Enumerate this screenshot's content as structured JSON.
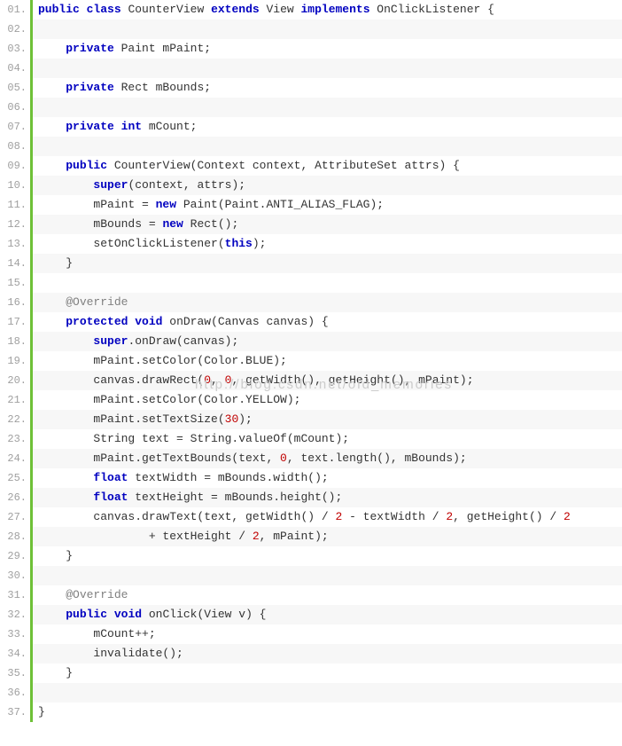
{
  "watermark": "http://blog.csdn.net/old_memories",
  "lines": [
    {
      "n": "01.",
      "tokens": [
        {
          "t": "txt",
          "v": ""
        },
        {
          "t": "kw",
          "v": "public"
        },
        {
          "t": "txt",
          "v": " "
        },
        {
          "t": "kw",
          "v": "class"
        },
        {
          "t": "txt",
          "v": " CounterView "
        },
        {
          "t": "kw",
          "v": "extends"
        },
        {
          "t": "txt",
          "v": " View "
        },
        {
          "t": "kw",
          "v": "implements"
        },
        {
          "t": "txt",
          "v": " OnClickListener {"
        }
      ]
    },
    {
      "n": "02.",
      "tokens": []
    },
    {
      "n": "03.",
      "tokens": [
        {
          "t": "txt",
          "v": "    "
        },
        {
          "t": "kw",
          "v": "private"
        },
        {
          "t": "txt",
          "v": " Paint mPaint;"
        }
      ]
    },
    {
      "n": "04.",
      "tokens": []
    },
    {
      "n": "05.",
      "tokens": [
        {
          "t": "txt",
          "v": "    "
        },
        {
          "t": "kw",
          "v": "private"
        },
        {
          "t": "txt",
          "v": " Rect mBounds;"
        }
      ]
    },
    {
      "n": "06.",
      "tokens": []
    },
    {
      "n": "07.",
      "tokens": [
        {
          "t": "txt",
          "v": "    "
        },
        {
          "t": "kw",
          "v": "private"
        },
        {
          "t": "txt",
          "v": " "
        },
        {
          "t": "kw",
          "v": "int"
        },
        {
          "t": "txt",
          "v": " mCount;"
        }
      ]
    },
    {
      "n": "08.",
      "tokens": []
    },
    {
      "n": "09.",
      "tokens": [
        {
          "t": "txt",
          "v": "    "
        },
        {
          "t": "kw",
          "v": "public"
        },
        {
          "t": "txt",
          "v": " CounterView(Context context, AttributeSet attrs) {"
        }
      ]
    },
    {
      "n": "10.",
      "tokens": [
        {
          "t": "txt",
          "v": "        "
        },
        {
          "t": "kw",
          "v": "super"
        },
        {
          "t": "txt",
          "v": "(context, attrs);"
        }
      ]
    },
    {
      "n": "11.",
      "tokens": [
        {
          "t": "txt",
          "v": "        mPaint = "
        },
        {
          "t": "kw",
          "v": "new"
        },
        {
          "t": "txt",
          "v": " Paint(Paint.ANTI_ALIAS_FLAG);"
        }
      ]
    },
    {
      "n": "12.",
      "tokens": [
        {
          "t": "txt",
          "v": "        mBounds = "
        },
        {
          "t": "kw",
          "v": "new"
        },
        {
          "t": "txt",
          "v": " Rect();"
        }
      ]
    },
    {
      "n": "13.",
      "tokens": [
        {
          "t": "txt",
          "v": "        setOnClickListener("
        },
        {
          "t": "kw",
          "v": "this"
        },
        {
          "t": "txt",
          "v": ");"
        }
      ]
    },
    {
      "n": "14.",
      "tokens": [
        {
          "t": "txt",
          "v": "    }"
        }
      ]
    },
    {
      "n": "15.",
      "tokens": []
    },
    {
      "n": "16.",
      "tokens": [
        {
          "t": "txt",
          "v": "    "
        },
        {
          "t": "annot",
          "v": "@Override"
        }
      ]
    },
    {
      "n": "17.",
      "tokens": [
        {
          "t": "txt",
          "v": "    "
        },
        {
          "t": "kw",
          "v": "protected"
        },
        {
          "t": "txt",
          "v": " "
        },
        {
          "t": "kw",
          "v": "void"
        },
        {
          "t": "txt",
          "v": " onDraw(Canvas canvas) {"
        }
      ]
    },
    {
      "n": "18.",
      "tokens": [
        {
          "t": "txt",
          "v": "        "
        },
        {
          "t": "kw",
          "v": "super"
        },
        {
          "t": "txt",
          "v": ".onDraw(canvas);"
        }
      ]
    },
    {
      "n": "19.",
      "tokens": [
        {
          "t": "txt",
          "v": "        mPaint.setColor(Color.BLUE);"
        }
      ]
    },
    {
      "n": "20.",
      "tokens": [
        {
          "t": "txt",
          "v": "        canvas.drawRect("
        },
        {
          "t": "num",
          "v": "0"
        },
        {
          "t": "txt",
          "v": ", "
        },
        {
          "t": "num",
          "v": "0"
        },
        {
          "t": "txt",
          "v": ", getWidth(), getHeight(), mPaint);"
        }
      ]
    },
    {
      "n": "21.",
      "tokens": [
        {
          "t": "txt",
          "v": "        mPaint.setColor(Color.YELLOW);"
        }
      ]
    },
    {
      "n": "22.",
      "tokens": [
        {
          "t": "txt",
          "v": "        mPaint.setTextSize("
        },
        {
          "t": "num",
          "v": "30"
        },
        {
          "t": "txt",
          "v": ");"
        }
      ]
    },
    {
      "n": "23.",
      "tokens": [
        {
          "t": "txt",
          "v": "        String text = String.valueOf(mCount);"
        }
      ]
    },
    {
      "n": "24.",
      "tokens": [
        {
          "t": "txt",
          "v": "        mPaint.getTextBounds(text, "
        },
        {
          "t": "num",
          "v": "0"
        },
        {
          "t": "txt",
          "v": ", text.length(), mBounds);"
        }
      ]
    },
    {
      "n": "25.",
      "tokens": [
        {
          "t": "txt",
          "v": "        "
        },
        {
          "t": "kw",
          "v": "float"
        },
        {
          "t": "txt",
          "v": " textWidth = mBounds.width();"
        }
      ]
    },
    {
      "n": "26.",
      "tokens": [
        {
          "t": "txt",
          "v": "        "
        },
        {
          "t": "kw",
          "v": "float"
        },
        {
          "t": "txt",
          "v": " textHeight = mBounds.height();"
        }
      ]
    },
    {
      "n": "27.",
      "tokens": [
        {
          "t": "txt",
          "v": "        canvas.drawText(text, getWidth() / "
        },
        {
          "t": "num",
          "v": "2"
        },
        {
          "t": "txt",
          "v": " - textWidth / "
        },
        {
          "t": "num",
          "v": "2"
        },
        {
          "t": "txt",
          "v": ", getHeight() / "
        },
        {
          "t": "num",
          "v": "2"
        }
      ]
    },
    {
      "n": "28.",
      "tokens": [
        {
          "t": "txt",
          "v": "                + textHeight / "
        },
        {
          "t": "num",
          "v": "2"
        },
        {
          "t": "txt",
          "v": ", mPaint);"
        }
      ]
    },
    {
      "n": "29.",
      "tokens": [
        {
          "t": "txt",
          "v": "    }"
        }
      ]
    },
    {
      "n": "30.",
      "tokens": []
    },
    {
      "n": "31.",
      "tokens": [
        {
          "t": "txt",
          "v": "    "
        },
        {
          "t": "annot",
          "v": "@Override"
        }
      ]
    },
    {
      "n": "32.",
      "tokens": [
        {
          "t": "txt",
          "v": "    "
        },
        {
          "t": "kw",
          "v": "public"
        },
        {
          "t": "txt",
          "v": " "
        },
        {
          "t": "kw",
          "v": "void"
        },
        {
          "t": "txt",
          "v": " onClick(View v) {"
        }
      ]
    },
    {
      "n": "33.",
      "tokens": [
        {
          "t": "txt",
          "v": "        mCount++;"
        }
      ]
    },
    {
      "n": "34.",
      "tokens": [
        {
          "t": "txt",
          "v": "        invalidate();"
        }
      ]
    },
    {
      "n": "35.",
      "tokens": [
        {
          "t": "txt",
          "v": "    }"
        }
      ]
    },
    {
      "n": "36.",
      "tokens": []
    },
    {
      "n": "37.",
      "tokens": [
        {
          "t": "txt",
          "v": "}"
        }
      ]
    }
  ]
}
